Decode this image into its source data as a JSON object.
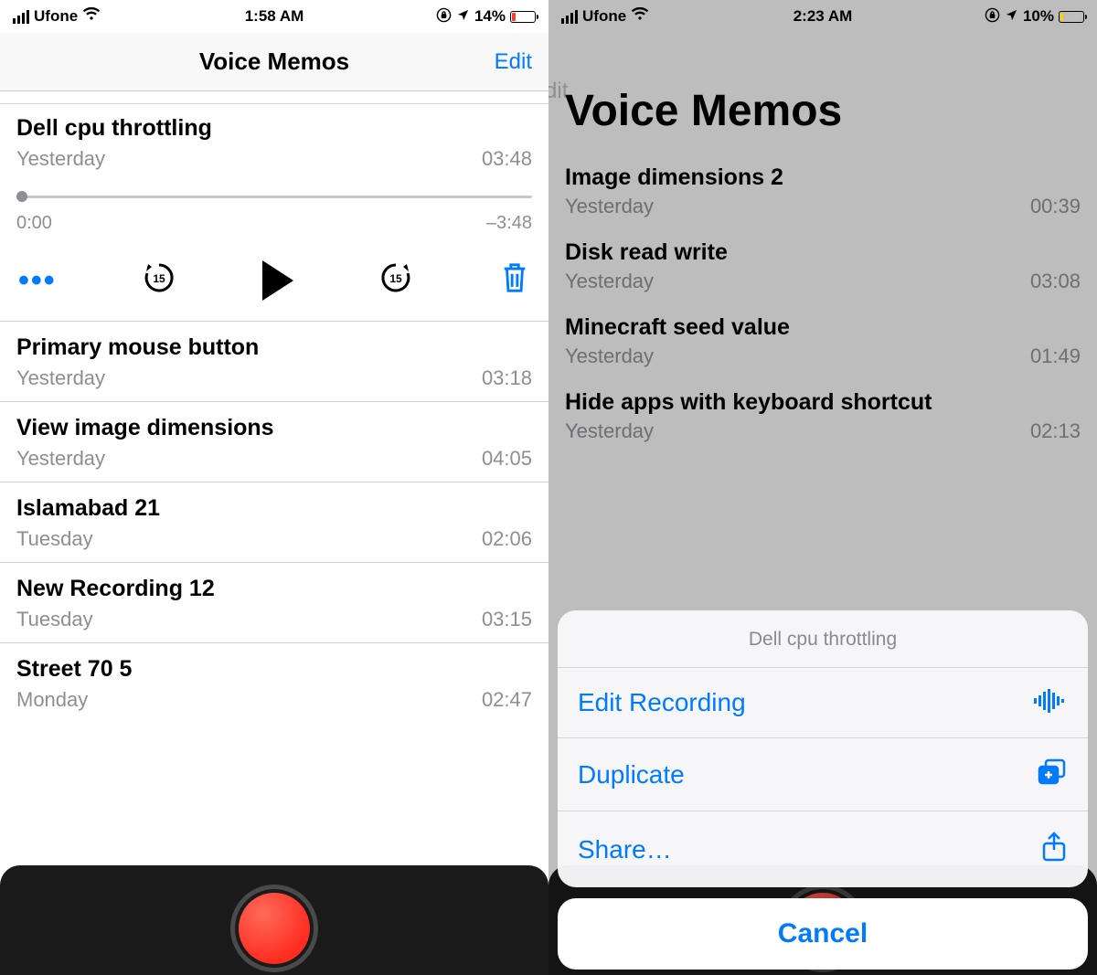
{
  "left": {
    "status": {
      "carrier": "Ufone",
      "time": "1:58 AM",
      "battery_pct": "14%"
    },
    "nav": {
      "title": "Voice Memos",
      "edit": "Edit"
    },
    "expanded": {
      "title": "Dell cpu throttling",
      "subtitle": "Yesterday",
      "duration": "03:48",
      "pos": "0:00",
      "remaining": "–3:48"
    },
    "rows": [
      {
        "title": "Primary mouse button",
        "subtitle": "Yesterday",
        "duration": "03:18"
      },
      {
        "title": "View image dimensions",
        "subtitle": "Yesterday",
        "duration": "04:05"
      },
      {
        "title": "Islamabad 21",
        "subtitle": "Tuesday",
        "duration": "02:06"
      },
      {
        "title": "New Recording 12",
        "subtitle": "Tuesday",
        "duration": "03:15"
      },
      {
        "title": "Street 70 5",
        "subtitle": "Monday",
        "duration": "02:47"
      }
    ]
  },
  "right": {
    "status": {
      "carrier": "Ufone",
      "time": "2:23 AM",
      "battery_pct": "10%"
    },
    "big_title": "Voice Memos",
    "edit": "Edit",
    "rows": [
      {
        "title": "Image dimensions 2",
        "subtitle": "Yesterday",
        "duration": "00:39"
      },
      {
        "title": "Disk read write",
        "subtitle": "Yesterday",
        "duration": "03:08"
      },
      {
        "title": "Minecraft seed value",
        "subtitle": "Yesterday",
        "duration": "01:49"
      },
      {
        "title": "Hide apps with keyboard shortcut",
        "subtitle": "Yesterday",
        "duration": "02:13"
      }
    ],
    "sheet": {
      "title": "Dell cpu throttling",
      "edit_recording": "Edit Recording",
      "duplicate": "Duplicate",
      "share": "Share…",
      "cancel": "Cancel"
    }
  }
}
